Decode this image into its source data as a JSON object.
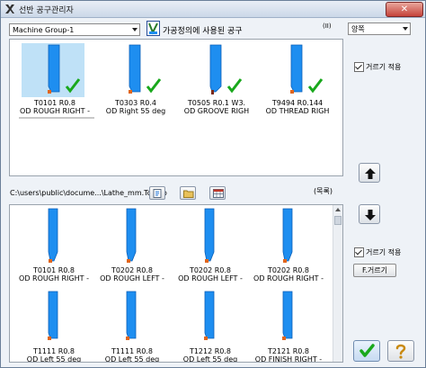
{
  "window": {
    "title": "선반 공구관리자",
    "close_glyph": "✕"
  },
  "toolbar": {
    "machine_group": "Machine Group-1",
    "filter_label": "가공정의에 사용된 공구",
    "marker": "(II)",
    "side_select": "양쪽"
  },
  "upper_tools": [
    {
      "line1": "T0101 R0.8",
      "line2": "OD ROUGH RIGHT -",
      "checked": true,
      "selected": true
    },
    {
      "line1": "T0303 R0.4",
      "line2": "OD Right 55 deg",
      "checked": true,
      "selected": false
    },
    {
      "line1": "T0505 R0.1 W3.",
      "line2": "OD GROOVE RIGH",
      "checked": true,
      "selected": false
    },
    {
      "line1": "T9494 R0.144",
      "line2": "OD THREAD RIGH",
      "checked": true,
      "selected": false
    }
  ],
  "upper_filter_label": "거르기 적용",
  "library": {
    "path": "C:\\users\\public\\docume...\\Lathe_mm.Tooldb",
    "list_label": "(목록)"
  },
  "lower_tools": [
    {
      "line1": "T0101 R0.8",
      "line2": "OD ROUGH RIGHT -"
    },
    {
      "line1": "T0202 R0.8",
      "line2": "OD ROUGH LEFT -"
    },
    {
      "line1": "T0202 R0.8",
      "line2": "OD ROUGH LEFT -"
    },
    {
      "line1": "T0202 R0.8",
      "line2": "OD ROUGH RIGHT -"
    },
    {
      "line1": "T1111 R0.8",
      "line2": "OD Left 55 deg"
    },
    {
      "line1": "T1111 R0.8",
      "line2": "OD Left 55 deg"
    },
    {
      "line1": "T1212 R0.8",
      "line2": "OD Left 55 deg"
    },
    {
      "line1": "T2121 R0.8",
      "line2": "OD FINISH RIGHT -"
    }
  ],
  "lower_filter_label": "거르기 적용",
  "filter_button": "F.거르기",
  "colors": {
    "tool_blue": "#1e8ef0",
    "tool_edge": "#0b5fb8",
    "insert_orange": "#e0661e",
    "check_green": "#19a81c"
  },
  "icons": {
    "upload_arrow": "up-arrow-icon",
    "download_arrow": "down-arrow-icon",
    "ok": "checkmark-icon",
    "help": "question-icon"
  }
}
